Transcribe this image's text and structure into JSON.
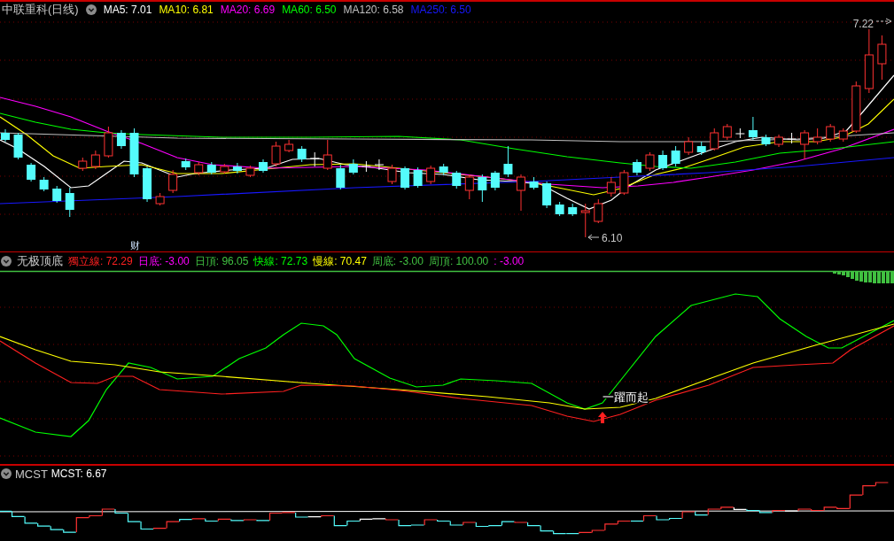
{
  "main_panel": {
    "title": "中联重科(日线)",
    "indicators": [
      {
        "text": "MA5: 7.01",
        "color": "#ffffff"
      },
      {
        "text": "MA10: 6.81",
        "color": "#ffff00"
      },
      {
        "text": "MA20: 6.69",
        "color": "#ff00ff"
      },
      {
        "text": "MA60: 6.50",
        "color": "#00ff00"
      },
      {
        "text": "MA120: 6.58",
        "color": "#c0c0c0"
      },
      {
        "text": "MA250: 6.50",
        "color": "#1818ff"
      }
    ],
    "high_label": "7.22",
    "low_label": "6.10",
    "event_marker": "财"
  },
  "indicator_panel": {
    "title": "无极顶底",
    "readings": [
      {
        "text": "獨立線: 72.29",
        "color": "#ff2020"
      },
      {
        "text": "日底: -3.00",
        "color": "#ff00ff"
      },
      {
        "text": "日頂: 96.05",
        "color": "#40c040"
      },
      {
        "text": "快線: 72.73",
        "color": "#00ff00"
      },
      {
        "text": "慢線: 70.47",
        "color": "#ffff00"
      },
      {
        "text": "周底: -3.00",
        "color": "#40c040"
      },
      {
        "text": "周頂: 100.00",
        "color": "#40c040"
      },
      {
        "text": ": -3.00",
        "color": "#ff00ff"
      }
    ],
    "signal_label": "一躍而起"
  },
  "cost_panel": {
    "title": "MCST",
    "reading": "MCST: 6.67"
  }
}
